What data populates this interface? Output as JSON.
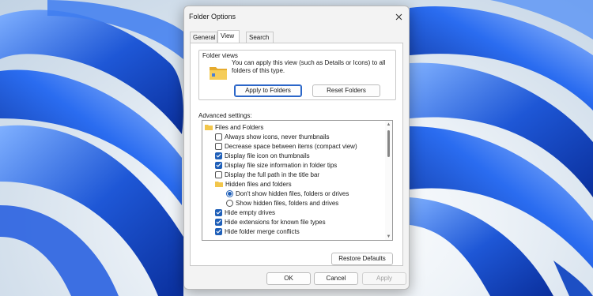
{
  "window": {
    "title": "Folder Options"
  },
  "tabs": [
    {
      "label": "General"
    },
    {
      "label": "View"
    },
    {
      "label": "Search"
    }
  ],
  "folder_views": {
    "title": "Folder views",
    "description": "You can apply this view (such as Details or Icons) to all folders of this type.",
    "apply_label": "Apply to Folders",
    "reset_label": "Reset Folders",
    "icon": "folder-icon"
  },
  "advanced": {
    "label": "Advanced settings:",
    "items": [
      {
        "type": "folder",
        "label": "Files and Folders"
      },
      {
        "type": "checkbox",
        "label": "Always show icons, never thumbnails",
        "checked": false
      },
      {
        "type": "checkbox",
        "label": "Decrease space between items (compact view)",
        "checked": false
      },
      {
        "type": "checkbox",
        "label": "Display file icon on thumbnails",
        "checked": true
      },
      {
        "type": "checkbox",
        "label": "Display file size information in folder tips",
        "checked": true
      },
      {
        "type": "checkbox",
        "label": "Display the full path in the title bar",
        "checked": false
      },
      {
        "type": "folder-sub",
        "label": "Hidden files and folders"
      },
      {
        "type": "radio",
        "label": "Don't show hidden files, folders or drives",
        "checked": true
      },
      {
        "type": "radio",
        "label": "Show hidden files, folders and drives",
        "checked": false
      },
      {
        "type": "checkbox",
        "label": "Hide empty drives",
        "checked": true
      },
      {
        "type": "checkbox",
        "label": "Hide extensions for known file types",
        "checked": true
      },
      {
        "type": "checkbox",
        "label": "Hide folder merge conflicts",
        "checked": true
      }
    ],
    "restore_label": "Restore Defaults"
  },
  "footer": {
    "ok_label": "OK",
    "cancel_label": "Cancel",
    "apply_label": "Apply"
  },
  "colors": {
    "accent": "#1f5fb8",
    "folder": "#f2c64b",
    "wallpaper_blue": "#1e57d6"
  }
}
